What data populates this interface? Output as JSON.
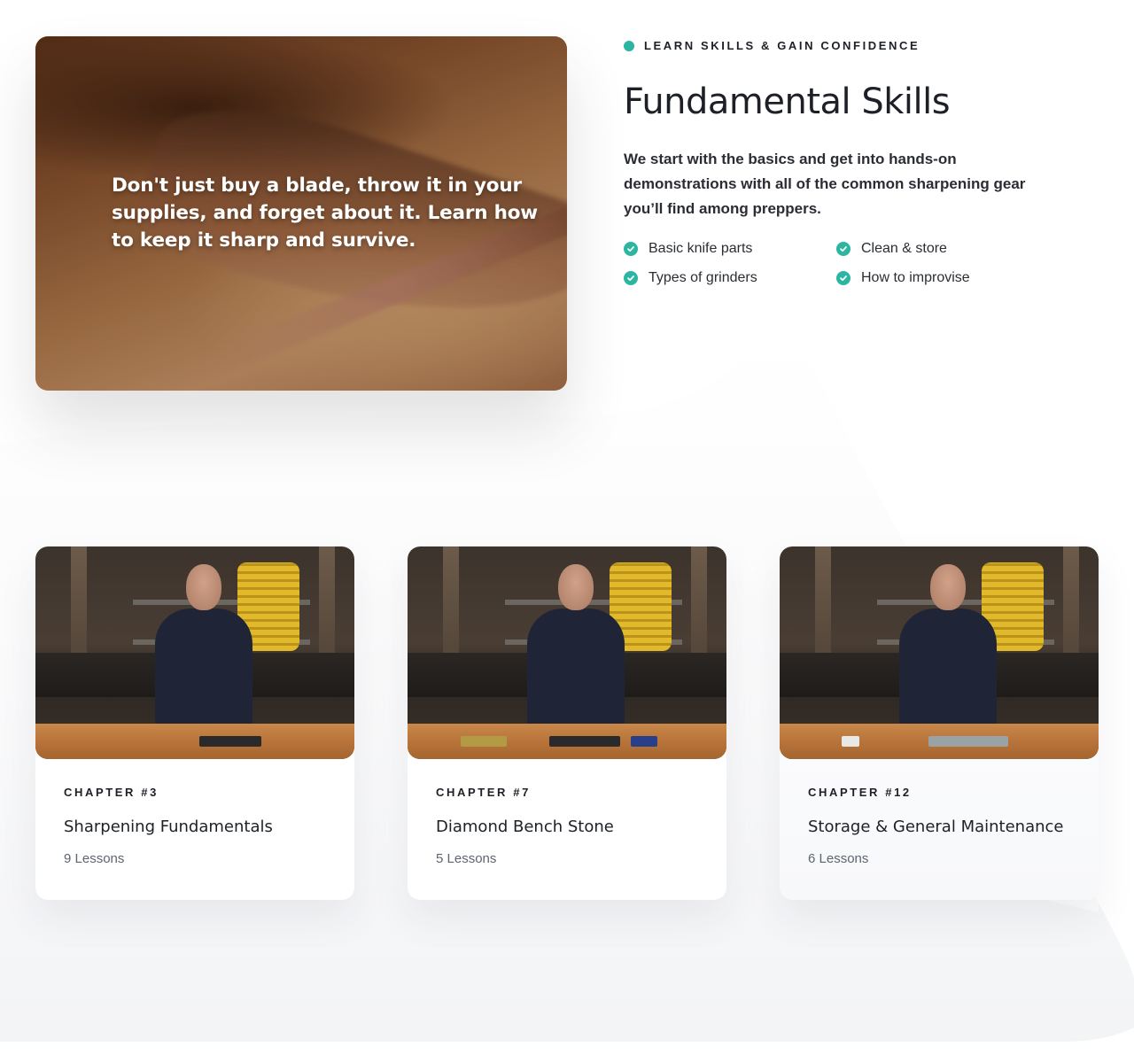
{
  "hero": {
    "quote": "Don't just buy a blade, throw it in your supplies, and forget about it. Learn how to keep it sharp and survive."
  },
  "section": {
    "eyebrow": "LEARN SKILLS & GAIN CONFIDENCE",
    "title": "Fundamental Skills",
    "description": "We start with the basics and get into hands-on demonstrations with all of the common sharpening gear you’ll find among preppers.",
    "features": [
      "Basic knife parts",
      "Clean & store",
      "Types of grinders",
      "How to improvise"
    ]
  },
  "chapters": [
    {
      "label": "CHAPTER #3",
      "title": "Sharpening Fundamentals",
      "lessons": "9 Lessons"
    },
    {
      "label": "CHAPTER #7",
      "title": "Diamond Bench Stone",
      "lessons": "5 Lessons"
    },
    {
      "label": "CHAPTER #12",
      "title": "Storage & General Maintenance",
      "lessons": "6 Lessons"
    }
  ],
  "colors": {
    "accent": "#2cb5a0",
    "text": "#1d2026",
    "muted": "#5e6470"
  },
  "icons": {
    "eyebrow": "dot-icon",
    "feature": "check-circle-icon"
  }
}
